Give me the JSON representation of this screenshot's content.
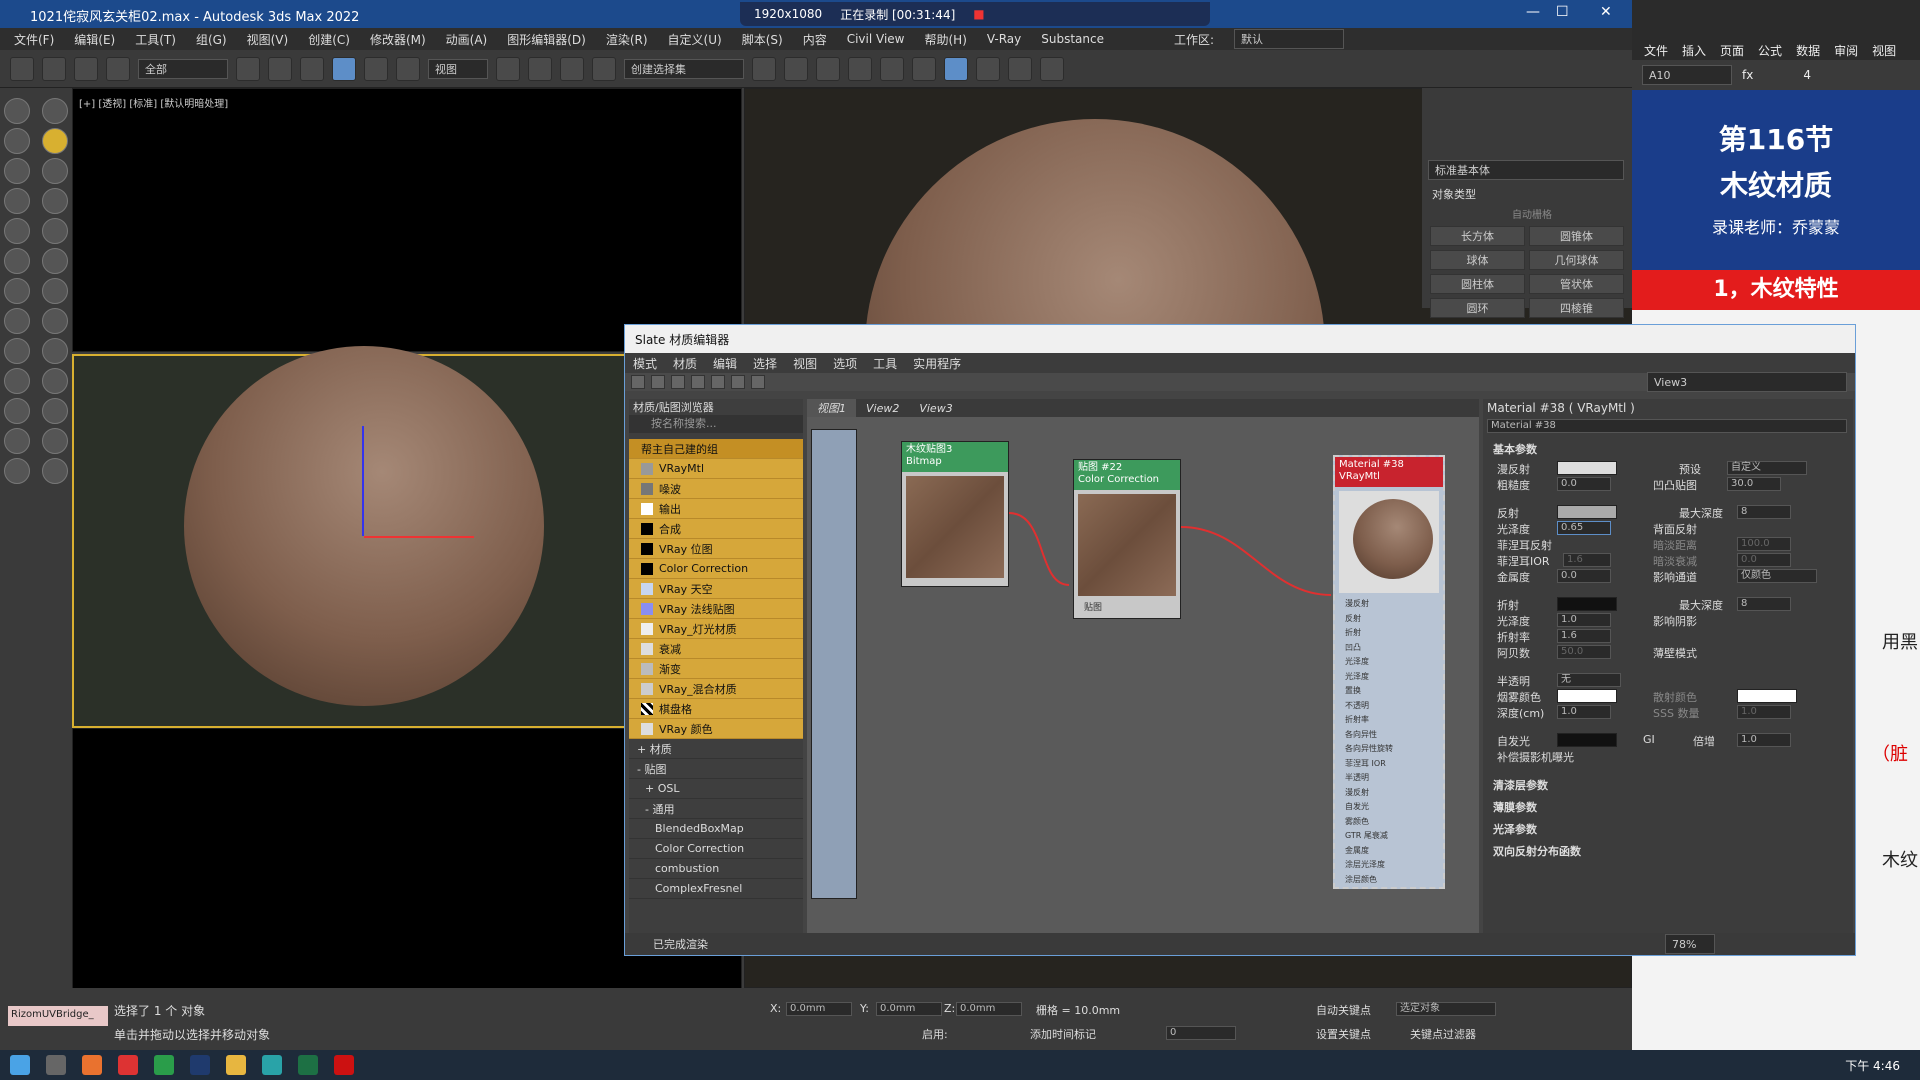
{
  "title_bar": {
    "title": "1021侘寂风玄关柜02.max - Autodesk 3ds Max 2022"
  },
  "recorder": {
    "resolution": "1920x1080",
    "status": "正在录制 [00:31:44]"
  },
  "menu": [
    "文件(F)",
    "编辑(E)",
    "工具(T)",
    "组(G)",
    "视图(V)",
    "创建(C)",
    "修改器(M)",
    "动画(A)",
    "图形编辑器(D)",
    "渲染(R)",
    "自定义(U)",
    "脚本(S)",
    "内容",
    "Civil View",
    "帮助(H)",
    "V-Ray",
    "Substance"
  ],
  "workspace": {
    "label": "工作区:",
    "value": "默认"
  },
  "toolbar": {
    "filter": "全部",
    "ref_coord": "视图",
    "selection_set": "创建选择集"
  },
  "viewport": {
    "label": "[+] [透视] [标准] [默认明暗处理]"
  },
  "command_panel": {
    "category": "标准基本体",
    "section": "对象类型",
    "autogrid": "自动栅格",
    "buttons": [
      "长方体",
      "圆锥体",
      "球体",
      "几何球体",
      "圆柱体",
      "管状体",
      "圆环",
      "四棱锥"
    ]
  },
  "excel": {
    "tabs": [
      "文件",
      "插入",
      "页面",
      "公式",
      "数据",
      "审阅",
      "视图"
    ],
    "cell_ref": "A10",
    "fx": "fx",
    "value": "4",
    "slide": {
      "title1": "第116节",
      "title2": "木纹材质",
      "teacher": "录课老师：乔蒙蒙",
      "point": "1，木纹特性"
    },
    "side_texts": [
      "用黑",
      "（脏",
      "木纹"
    ]
  },
  "slate": {
    "title": "Slate 材质编辑器",
    "menu": [
      "模式",
      "材质",
      "编辑",
      "选择",
      "视图",
      "选项",
      "工具",
      "实用程序"
    ],
    "view_dropdown": "View3",
    "browser": {
      "title": "材质/贴图浏览器",
      "search": "按名称搜索...",
      "group": "帮主自己建的组",
      "items": [
        "VRayMtl",
        "噪波",
        "输出",
        "合成",
        "VRay 位图",
        "Color Correction",
        "VRay 天空",
        "VRay 法线贴图",
        "VRay_灯光材质",
        "衰减",
        "渐变",
        "VRay_混合材质",
        "棋盘格",
        "VRay 颜色"
      ],
      "sections": [
        "+ 材质",
        "- 贴图",
        "+ OSL",
        "- 通用"
      ],
      "general": [
        "BlendedBoxMap",
        "Color Correction",
        "combustion",
        "ComplexFresnel"
      ]
    },
    "tabs": [
      "视图1",
      "View2",
      "View3"
    ],
    "nodes": {
      "bitmap": {
        "title": "木纹贴图3",
        "subtitle": "Bitmap"
      },
      "cc": {
        "title": "贴图 #22",
        "subtitle": "Color Correction",
        "port": "贴图"
      },
      "mat": {
        "title": "Material #38",
        "subtitle": "VRayMtl",
        "slots": [
          "漫反射",
          "反射",
          "折射",
          "凹凸",
          "光泽度",
          "光泽度",
          "置换",
          "不透明",
          "折射率",
          "各向异性",
          "各向异性旋转",
          "菲涅耳 IOR",
          "半透明",
          "漫反射",
          "自发光",
          "雾颜色",
          "GTR 尾衰减",
          "金属度",
          "涂层光泽度",
          "涂层颜色"
        ]
      }
    },
    "params": {
      "header": "Material #38 ( VRayMtl )",
      "name": "Material #38",
      "basic": "基本参数",
      "diffuse": "漫反射",
      "roughness": "粗糙度",
      "roughness_v": "0.0",
      "preset": "预设",
      "preset_v": "自定义",
      "bump": "凹凸贴图",
      "bump_v": "30.0",
      "reflect": "反射",
      "gloss": "光泽度",
      "gloss_v": "0.65",
      "max_depth": "最大深度",
      "max_depth_v": "8",
      "back": "背面反射",
      "fresnel": "菲涅耳反射",
      "dim_dist": "暗淡距离",
      "dim_dist_v": "100.0",
      "fresnel_ior": "菲涅耳IOR",
      "fresnel_ior_v": "1.6",
      "dim_fall": "暗淡衰减",
      "dim_fall_v": "0.0",
      "metal": "金属度",
      "metal_v": "0.0",
      "affect": "影响通道",
      "affect_v": "仅颜色",
      "refract": "折射",
      "r_depth": "最大深度",
      "r_depth_v": "8",
      "r_gloss": "光泽度",
      "r_gloss_v": "1.0",
      "shadow": "影响阴影",
      "ior": "折射率",
      "ior_v": "1.6",
      "abbe": "阿贝数",
      "abbe_v": "50.0",
      "thin": "薄壁模式",
      "translucent": "半透明",
      "translucent_v": "无",
      "fog": "烟雾颜色",
      "scatter": "散射颜色",
      "depth": "深度(cm)",
      "depth_v": "1.0",
      "sss": "SSS 数量",
      "sss_v": "1.0",
      "emissive": "自发光",
      "gi": "GI",
      "mult": "倍增",
      "mult_v": "1.0",
      "comp": "补偿摄影机曝光",
      "rollouts": [
        "清漆层参数",
        "薄膜参数",
        "光泽参数",
        "双向反射分布函数"
      ]
    },
    "status": "已完成渲染",
    "zoom": "78%"
  },
  "status": {
    "selected": "选择了 1 个 对象",
    "hint": "单击并拖动以选择并移动对象",
    "script": "RizomUVBridge_",
    "x": "0.0mm",
    "y": "0.0mm",
    "z": "0.0mm",
    "grid": "栅格 = 10.0mm",
    "autokey": "自动关键点",
    "setkey": "设置关键点",
    "sel_obj": "选定对象",
    "filter": "关键点过滤器",
    "time_tag": "添加时间标记",
    "enable": "启用:",
    "frame": "0"
  },
  "taskbar": {
    "time": "下午 4:46"
  }
}
